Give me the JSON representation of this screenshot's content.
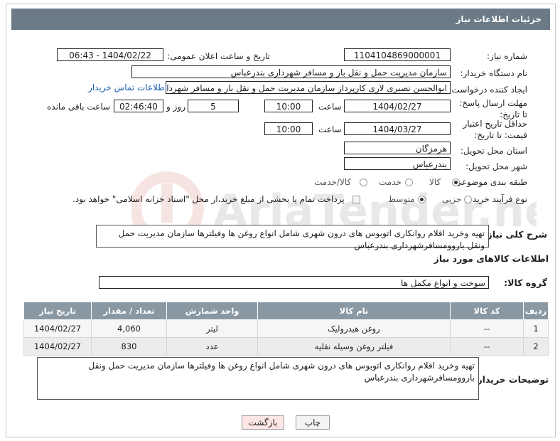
{
  "page": {
    "title": "جزئیات اطلاعات نیاز"
  },
  "labels": {
    "need_number": "شماره نیاز:",
    "announce_datetime": "تاریخ و ساعت اعلان عمومی:",
    "buyer_org": "نام دستگاه خریدار:",
    "requester": "ایجاد کننده درخواست:",
    "reply_deadline": "مهلت ارسال پاسخ: تا تاریخ:",
    "price_validity": "حداقل تاریخ اعتبار قیمت: تا تاریخ:",
    "delivery_province": "استان محل تحویل:",
    "delivery_city": "شهر محل تحویل:",
    "category": "طبقه بندی موضوعی:",
    "purchase_type": "نوع فرآیند خرید :",
    "time": "ساعت",
    "day_and": "روز و",
    "remaining": "ساعت باقی مانده"
  },
  "fields": {
    "need_number": "1104104869000001",
    "announce_datetime": "1404/02/22 - 06:43",
    "buyer_org": "سازمان مدیریت حمل و نقل بار و مسافر شهرداری بندرعباس",
    "requester": "ابوالحسن نصیری لاری کارپرداز سازمان مدیریت حمل و نقل بار و مسافر شهرداری",
    "contact_link": "اطلاعات تماس خریدار",
    "reply_date": "1404/02/27",
    "reply_time": "10:00",
    "reply_days": "5",
    "reply_remaining": "02:46:40",
    "validity_date": "1404/03/27",
    "validity_time": "10:00",
    "province": "هرمزگان",
    "city": "بندرعباس"
  },
  "category_options": [
    "کالا",
    "خدمت",
    "کالا/خدمت"
  ],
  "category_selected": "کالا",
  "purchase_options": [
    "جزیی",
    "متوسط"
  ],
  "purchase_selected": "متوسط",
  "payment_note": "پرداخت تمام یا بخشی از مبلغ خرید،از محل \"اسناد خزانه اسلامی\" خواهد بود.",
  "summary": {
    "label": "شرح کلی نیاز:",
    "text": "تهیه وخرید اقلام روانکاری اتوبوس های درون شهری شامل انواع روغن ها وفیلترها سازمان مدیریت حمل ونقل باروومسافرشهرداری بندرعباس"
  },
  "goods_section": {
    "title": "اطلاعات کالاهای مورد نیاز",
    "group_label": "گروه کالا:",
    "group_value": "سوخت و انواع مکمل ها"
  },
  "table": {
    "headers": [
      "ردیف",
      "کد کالا",
      "نام کالا",
      "واحد شمارش",
      "تعداد / مقدار",
      "تاریخ نیاز"
    ],
    "rows": [
      [
        "1",
        "--",
        "روغن هیدرولیک",
        "لیتر",
        "4,060",
        "1404/02/27"
      ],
      [
        "2",
        "--",
        "فیلتر روغن وسیله نقلیه",
        "عدد",
        "830",
        "1404/02/27"
      ]
    ]
  },
  "buyer_notes": {
    "label": "توضیحات خریدار:",
    "text": "تهیه وخرید اقلام روانکاری اتوبوس های درون شهری شامل انواع روغن ها وفیلترها سازمان مدیریت حمل ونقل باروومسافرشهرداری بندرعباس"
  },
  "buttons": {
    "print": "چاپ",
    "back": "بازگشت"
  },
  "watermark": {
    "text": "AriaTender.neT"
  },
  "colors": {
    "header": "#6b7a86",
    "table_header": "#8a98a3",
    "link": "#1a5fb4",
    "back_button": "#fde6e6",
    "print_button": "#f3f3f3"
  }
}
